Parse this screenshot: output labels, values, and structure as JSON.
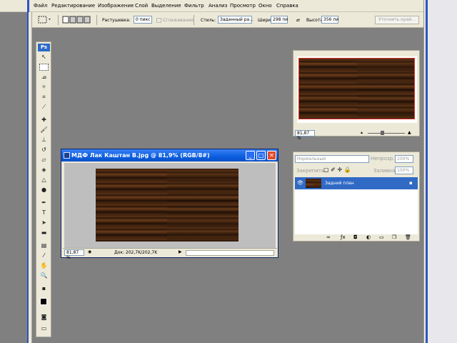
{
  "menu": [
    "Файл",
    "Редактирование",
    "Изображение",
    "Слой",
    "Выделение",
    "Фильтр",
    "Анализ",
    "Просмотр",
    "Окно",
    "Справка"
  ],
  "options": {
    "feather_label": "Растушевка:",
    "feather_value": "0 пикс",
    "antialias_label": "Сглаживание",
    "style_label": "Стиль:",
    "style_value": "Заданный ра...",
    "width_label": "Ширина:",
    "width_value": "298 пи",
    "height_label": "Высота:",
    "height_value": "356 пи",
    "refine_label": "Уточнить край..."
  },
  "toolbox": {
    "logo": "Ps"
  },
  "document": {
    "title": "МДФ Лак Каштан В.jpg @ 81,9% (RGB/8#)",
    "zoom": "81,87 %",
    "doc_info": "Док: 202,7K/202,7K"
  },
  "navigator": {
    "zoom": "81,87 %"
  },
  "layers": {
    "blend_mode": "Нормальный",
    "opacity_label": "Непрозр.:",
    "opacity_value": "100%",
    "lock_label": "Закрепить:",
    "fill_label": "Заливка:",
    "fill_value": "100%",
    "layer_name": "Задний план"
  },
  "colors": {
    "accent": "#316ac5",
    "title_bar": "#0a5ee0",
    "nav_frame": "#e0302a"
  }
}
